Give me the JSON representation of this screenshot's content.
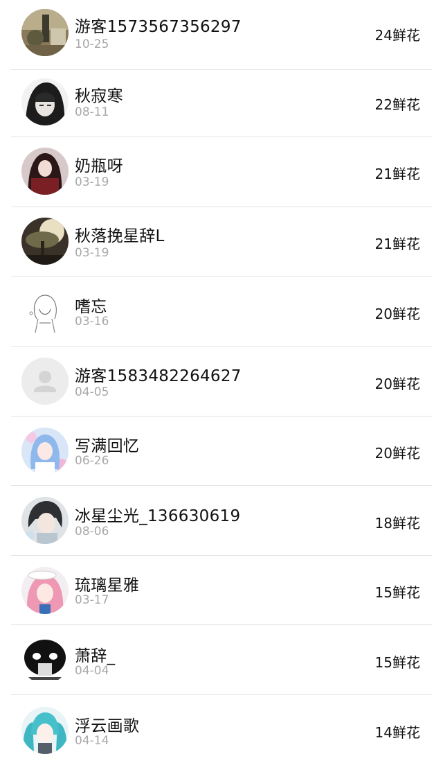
{
  "rows": [
    {
      "name": "游客1573567356297",
      "date": "10-25",
      "flowers": "24鲜花",
      "avatar": "avatar-photo-icon"
    },
    {
      "name": "秋寂寒",
      "date": "08-11",
      "flowers": "22鲜花",
      "avatar": "avatar-hooded-figure-icon"
    },
    {
      "name": "奶瓶呀",
      "date": "03-19",
      "flowers": "21鲜花",
      "avatar": "avatar-anime-dark-hair-icon"
    },
    {
      "name": "秋落挽星辞L",
      "date": "03-19",
      "flowers": "21鲜花",
      "avatar": "avatar-tree-scenery-icon"
    },
    {
      "name": "嗜忘",
      "date": "03-16",
      "flowers": "20鲜花",
      "avatar": "avatar-sketch-girl-icon"
    },
    {
      "name": "游客1583482264627",
      "date": "04-05",
      "flowers": "20鲜花",
      "avatar": "avatar-default-user-icon"
    },
    {
      "name": "写满回忆",
      "date": "06-26",
      "flowers": "20鲜花",
      "avatar": "avatar-anime-blue-hair-icon"
    },
    {
      "name": "冰星尘光_136630619",
      "date": "08-06",
      "flowers": "18鲜花",
      "avatar": "avatar-anime-boy-icon"
    },
    {
      "name": "琉璃星雅",
      "date": "03-17",
      "flowers": "15鲜花",
      "avatar": "avatar-anime-pink-hair-icon"
    },
    {
      "name": "萧辞_",
      "date": "04-04",
      "flowers": "15鲜花",
      "avatar": "avatar-meme-face-icon"
    },
    {
      "name": "浮云画歌",
      "date": "04-14",
      "flowers": "14鲜花",
      "avatar": "avatar-anime-teal-twintails-icon"
    }
  ],
  "colors": {
    "name_text": "#111111",
    "date_text": "#a8a8a8",
    "divider": "#e3e3e3",
    "default_avatar_bg": "#ececec",
    "default_avatar_fg": "#d4d4d4"
  }
}
